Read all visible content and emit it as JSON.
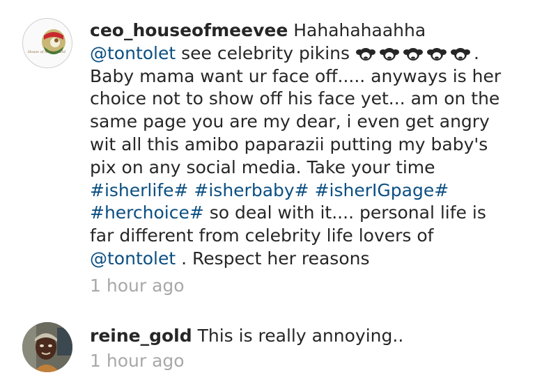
{
  "comments": [
    {
      "username": "ceo_houseofmeevee",
      "avatar_caption": "House of Meevee Ltd",
      "segments": [
        {
          "type": "text",
          "text": " Hahahahaahha "
        },
        {
          "type": "mention",
          "text": "@tontolet"
        },
        {
          "type": "text",
          "text": " see celebrity pikins "
        },
        {
          "type": "emoji",
          "name": "see-no-evil-monkey-icon"
        },
        {
          "type": "emoji",
          "name": "see-no-evil-monkey-icon"
        },
        {
          "type": "emoji",
          "name": "see-no-evil-monkey-icon"
        },
        {
          "type": "emoji",
          "name": "see-no-evil-monkey-icon"
        },
        {
          "type": "emoji",
          "name": "see-no-evil-monkey-icon"
        },
        {
          "type": "text",
          "text": ". Baby mama want ur face off..... anyways is her choice not to show off his face yet... am on the same page you are my dear, i even get angry wit all this amibo paparazii putting my baby's pix on any social media. Take your time "
        },
        {
          "type": "hashtag",
          "text": "#isherlife#"
        },
        {
          "type": "text",
          "text": " "
        },
        {
          "type": "hashtag",
          "text": "#isherbaby#"
        },
        {
          "type": "text",
          "text": " "
        },
        {
          "type": "hashtag",
          "text": "#isherIGpage#"
        },
        {
          "type": "text",
          "text": " "
        },
        {
          "type": "hashtag",
          "text": "#herchoice#"
        },
        {
          "type": "text",
          "text": " so deal with it.... personal life is far different from celebrity life lovers of "
        },
        {
          "type": "mention",
          "text": "@tontolet"
        },
        {
          "type": "text",
          "text": " . Respect her reasons"
        }
      ],
      "time": "1 hour ago"
    },
    {
      "username": "reine_gold",
      "segments": [
        {
          "type": "text",
          "text": " This is really annoying.."
        }
      ],
      "time": "1 hour ago"
    }
  ],
  "colors": {
    "link": "#0b4f82",
    "text": "#262626",
    "timestamp": "#a8a8a8",
    "background": "#ffffff"
  }
}
